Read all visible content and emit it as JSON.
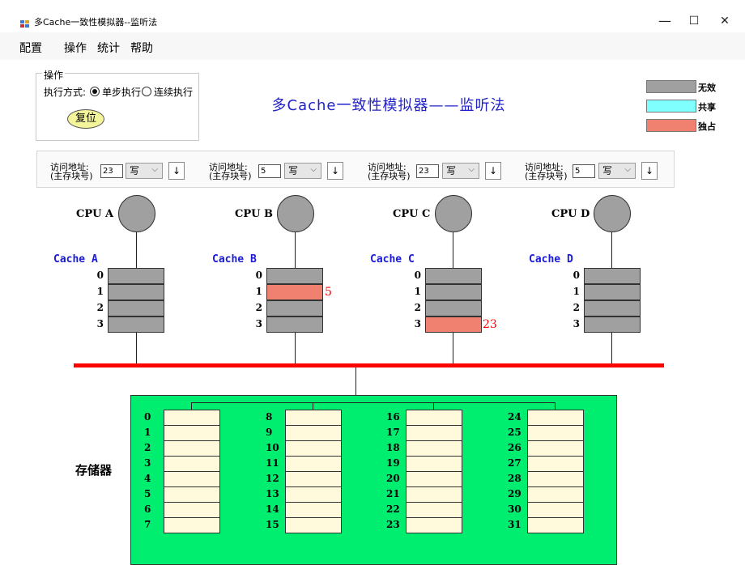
{
  "window": {
    "title": "多Cache一致性模拟器--监听法",
    "minimize": "—",
    "maximize": "☐",
    "close": "✕"
  },
  "menu": [
    "配置",
    "操作",
    "统计",
    "帮助"
  ],
  "operation": {
    "group_label": "操作",
    "mode_label": "执行方式:",
    "options": [
      {
        "label": "单步执行",
        "selected": true
      },
      {
        "label": "连续执行",
        "selected": false
      }
    ],
    "reset_label": "复位"
  },
  "main_title": "多Cache一致性模拟器——监听法",
  "legend": [
    {
      "label": "无效",
      "color": "#a0a0a0"
    },
    {
      "label": "共享",
      "color": "#80ffff"
    },
    {
      "label": "独占",
      "color": "#f08070"
    }
  ],
  "access": {
    "label_line1": "访问地址:",
    "label_line2": "(主存块号)",
    "button_icon": "↓",
    "controls": [
      {
        "address": "23",
        "op": "写"
      },
      {
        "address": "5",
        "op": "写"
      },
      {
        "address": "23",
        "op": "写"
      },
      {
        "address": "5",
        "op": "写"
      }
    ]
  },
  "cpus": [
    {
      "name": "CPU A",
      "cache": "Cache A",
      "lines": [
        {
          "index": "0",
          "state": "invalid",
          "tag": ""
        },
        {
          "index": "1",
          "state": "invalid",
          "tag": ""
        },
        {
          "index": "2",
          "state": "invalid",
          "tag": ""
        },
        {
          "index": "3",
          "state": "invalid",
          "tag": ""
        }
      ]
    },
    {
      "name": "CPU B",
      "cache": "Cache B",
      "lines": [
        {
          "index": "0",
          "state": "invalid",
          "tag": ""
        },
        {
          "index": "1",
          "state": "exclusive",
          "tag": "5"
        },
        {
          "index": "2",
          "state": "invalid",
          "tag": ""
        },
        {
          "index": "3",
          "state": "invalid",
          "tag": ""
        }
      ]
    },
    {
      "name": "CPU C",
      "cache": "Cache C",
      "lines": [
        {
          "index": "0",
          "state": "invalid",
          "tag": ""
        },
        {
          "index": "1",
          "state": "invalid",
          "tag": ""
        },
        {
          "index": "2",
          "state": "invalid",
          "tag": ""
        },
        {
          "index": "3",
          "state": "exclusive",
          "tag": "23"
        }
      ]
    },
    {
      "name": "CPU D",
      "cache": "Cache D",
      "lines": [
        {
          "index": "0",
          "state": "invalid",
          "tag": ""
        },
        {
          "index": "1",
          "state": "invalid",
          "tag": ""
        },
        {
          "index": "2",
          "state": "invalid",
          "tag": ""
        },
        {
          "index": "3",
          "state": "invalid",
          "tag": ""
        }
      ]
    }
  ],
  "memory": {
    "title": "存储器",
    "columns": [
      [
        "0",
        "1",
        "2",
        "3",
        "4",
        "5",
        "6",
        "7"
      ],
      [
        "8",
        "9",
        "10",
        "11",
        "12",
        "13",
        "14",
        "15"
      ],
      [
        "16",
        "17",
        "18",
        "19",
        "20",
        "21",
        "22",
        "23"
      ],
      [
        "24",
        "25",
        "26",
        "27",
        "28",
        "29",
        "30",
        "31"
      ]
    ]
  }
}
